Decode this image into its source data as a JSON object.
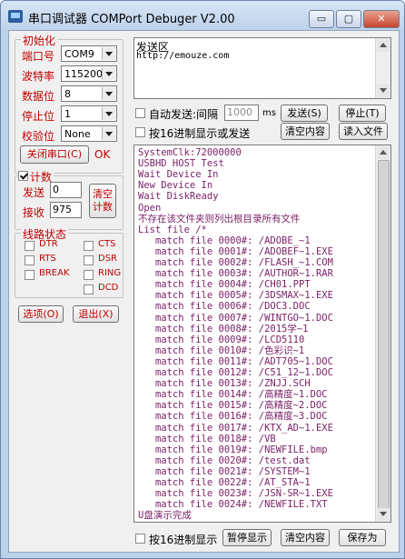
{
  "window": {
    "title": "串口调试器 COMPort Debuger V2.00",
    "min_symbol": "▭",
    "max_symbol": "▢",
    "close_symbol": "✕"
  },
  "init": {
    "group_title": "初始化",
    "port_label": "端口号",
    "port_value": "COM9",
    "baud_label": "波特率",
    "baud_value": "115200",
    "data_label": "数据位",
    "data_value": "8",
    "stop_label": "停止位",
    "stop_value": "1",
    "parity_label": "校验位",
    "parity_value": "None",
    "close_port_button": "关闭串口(C)",
    "status": "OK"
  },
  "count": {
    "group_title": "计数",
    "send_label": "发送",
    "send_value": "0",
    "recv_label": "接收",
    "recv_value": "975",
    "clear_button": "清空计数"
  },
  "line_status": {
    "group_title": "线路状态",
    "items": [
      "DTR",
      "CTS",
      "RTS",
      "DSR",
      "BREAK",
      "RING",
      "DCD"
    ]
  },
  "buttons": {
    "options": "选项(O)",
    "exit": "退出(X)"
  },
  "send_area": {
    "label": "发送区",
    "content": "http://emouze.com",
    "auto_send_label": "自动发送:间隔",
    "interval_value": "1000",
    "interval_unit": "ms",
    "send_button": "发送(S)",
    "stop_button": "停止(T)",
    "hex_send_label": "按16进制显示或发送",
    "clear_button": "清空内容",
    "read_file_button": "读入文件"
  },
  "receive_area": {
    "lines": [
      "SystemClk:72000000",
      "USBHD HOST Test",
      "Wait Device In",
      "New Device In",
      "Wait DiskReady",
      "Open",
      "不存在该文件夹则列出根目录所有文件",
      "List file /*",
      "   match file 0000#: /ADOBE_~1",
      "   match file 0001#: /ADOBEF~1.EXE",
      "   match file 0002#: /FLASH_~1.COM",
      "   match file 0003#: /AUTHOR~1.RAR",
      "   match file 0004#: /CH01.PPT",
      "   match file 0005#: /3DSMAX~1.EXE",
      "   match file 0006#: /DOC3.DOC",
      "   match file 0007#: /WINTGO~1.DOC",
      "   match file 0008#: /2015学~1",
      "   match file 0009#: /LCD5110",
      "   match file 0010#: /色彩识~1",
      "   match file 0011#: /ADT705~1.DOC",
      "   match file 0012#: /C51_12~1.DOC",
      "   match file 0013#: /ZNJJ.SCH",
      "   match file 0014#: /高精度~1.DOC",
      "   match file 0015#: /高精度~2.DOC",
      "   match file 0016#: /高精度~3.DOC",
      "   match file 0017#: /KTX_AD~1.EXE",
      "   match file 0018#: /VB",
      "   match file 0019#: /NEWFILE.bmp",
      "   match file 0020#: /test.dat",
      "   match file 0021#: /SYSTEM~1",
      "   match file 0022#: /AT_STA~1",
      "   match file 0023#: /JSN-SR~1.EXE",
      "   match file 0024#: /NEWFILE.TXT",
      "U盘演示完成"
    ]
  },
  "bottom_bar": {
    "hex_display_label": "按16进制显示",
    "pause_button": "暂停显示",
    "clear_button": "清空内容",
    "save_button": "保存为"
  }
}
